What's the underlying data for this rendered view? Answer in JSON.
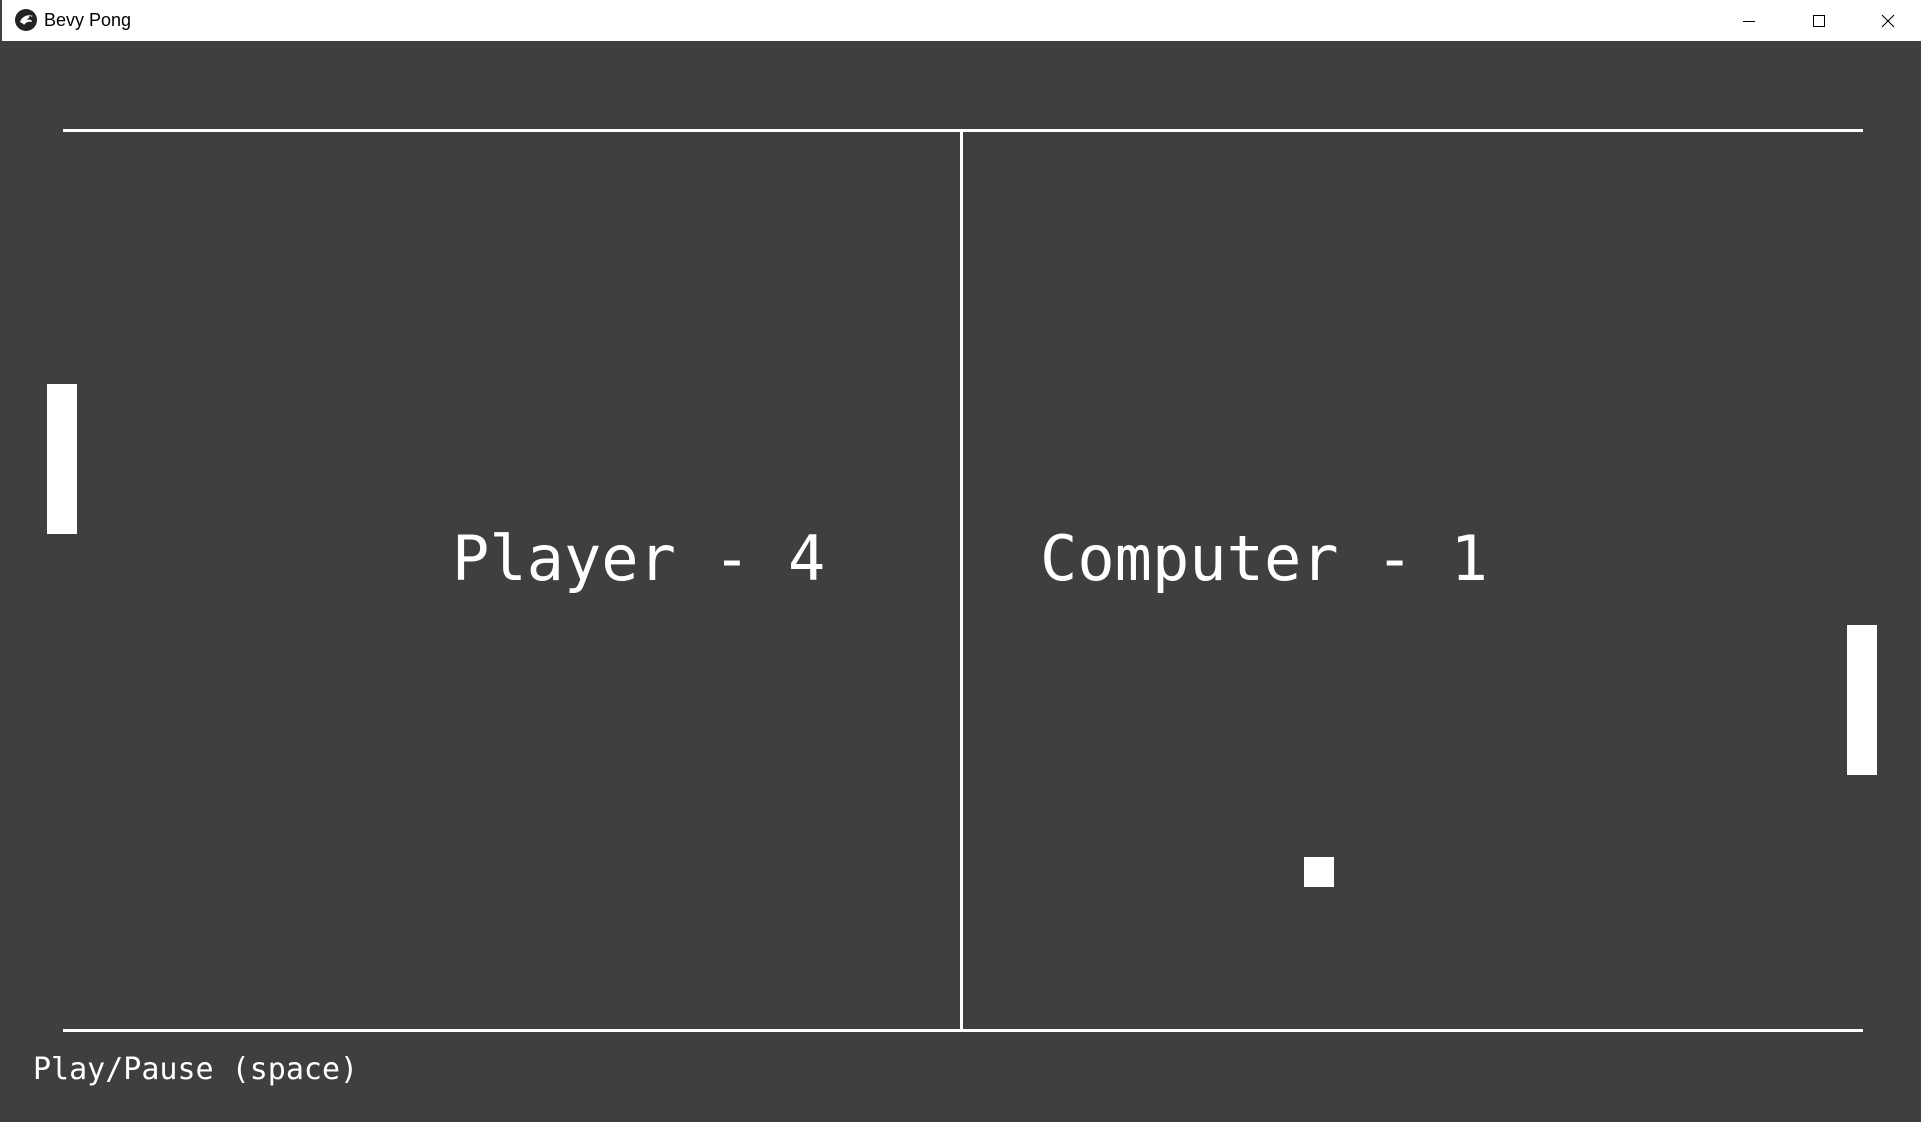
{
  "window": {
    "title": "Bevy Pong",
    "icon": "bevy-bird-icon",
    "controls": [
      "minimize-icon",
      "maximize-icon",
      "close-icon"
    ]
  },
  "scoreboard": {
    "player": "Player - 4",
    "computer": "Computer - 1"
  },
  "hint": "Play/Pause (space)",
  "colors": {
    "background": "#3f3f3f",
    "foreground": "#ffffff",
    "titlebar": "#ffffff"
  }
}
